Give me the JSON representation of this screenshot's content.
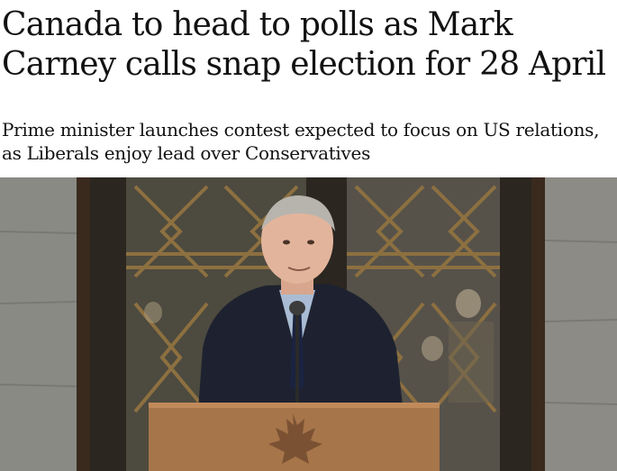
{
  "article": {
    "headline": "Canada to head to polls as Mark Carney calls snap election for 28 April",
    "standfirst": "Prime minister launches contest expected to focus on US relations, as Liberals enjoy lead over Conservatives"
  },
  "photo": {
    "subject": "Mark Carney speaking at wooden lectern with maple leaf emblem in front of ornate doors",
    "icon": "photo-image"
  },
  "colors": {
    "text": "#121212",
    "background": "#ffffff",
    "stone": "#8a8a84",
    "wood": "#a7754a",
    "suit": "#1e2230"
  }
}
